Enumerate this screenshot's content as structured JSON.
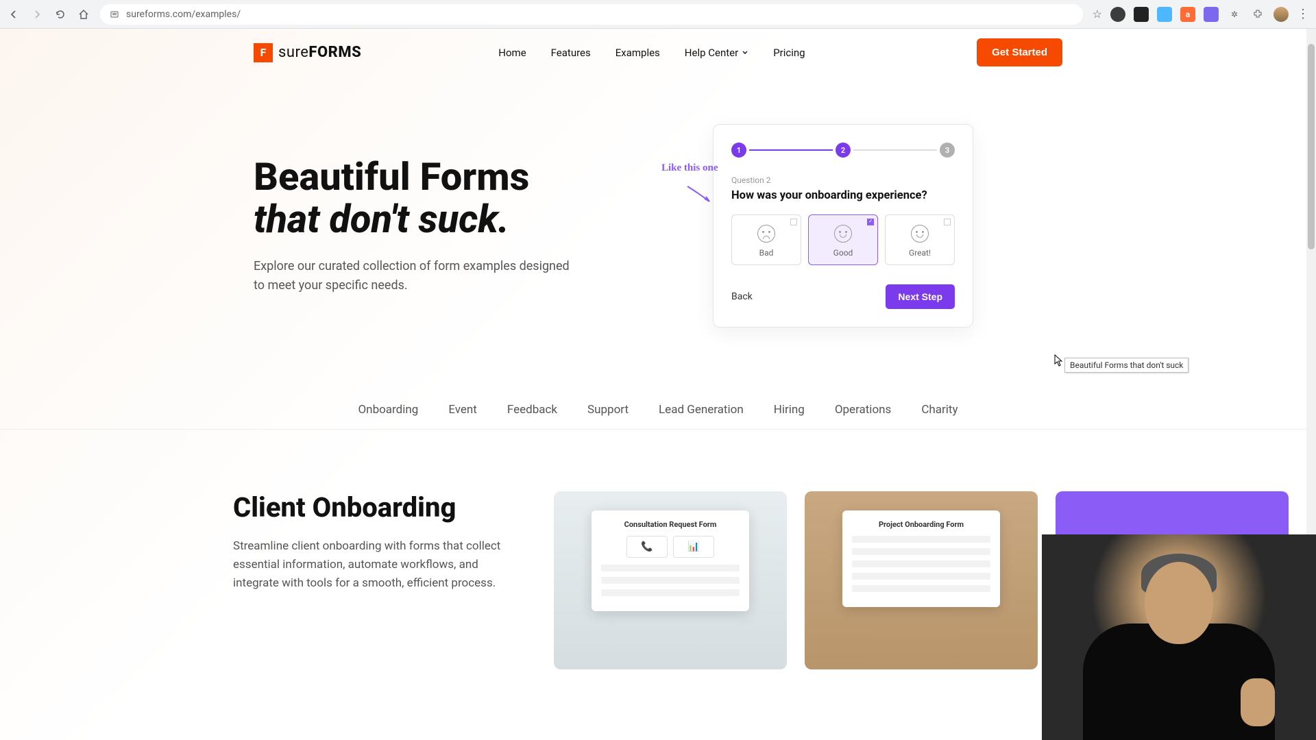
{
  "browser": {
    "url": "sureforms.com/examples/"
  },
  "brand": {
    "name_light": "sure",
    "name_bold": "FORMS"
  },
  "nav": {
    "items": [
      "Home",
      "Features",
      "Examples",
      "Help Center",
      "Pricing"
    ],
    "cta": "Get Started"
  },
  "hero": {
    "title_line1": "Beautiful Forms",
    "title_line2": "that don't suck.",
    "subtitle": "Explore our curated collection of form examples designed to meet your specific needs.",
    "annotation": "Like this one"
  },
  "form_card": {
    "steps": [
      "1",
      "2",
      "3"
    ],
    "question_label": "Question 2",
    "question_text": "How was your onboarding experience?",
    "options": [
      {
        "label": "Bad"
      },
      {
        "label": "Good"
      },
      {
        "label": "Great!"
      }
    ],
    "back": "Back",
    "next": "Next Step"
  },
  "tooltip": "Beautiful Forms that don't suck",
  "categories": [
    "Onboarding",
    "Event",
    "Feedback",
    "Support",
    "Lead Generation",
    "Hiring",
    "Operations",
    "Charity"
  ],
  "section": {
    "title": "Client Onboarding",
    "desc": "Streamline client onboarding with forms that collect essential information, automate workflows, and integrate with tools for a smooth, efficient process.",
    "card1_title": "Consultation Request Form",
    "card2_title": "Project Onboarding Form"
  }
}
